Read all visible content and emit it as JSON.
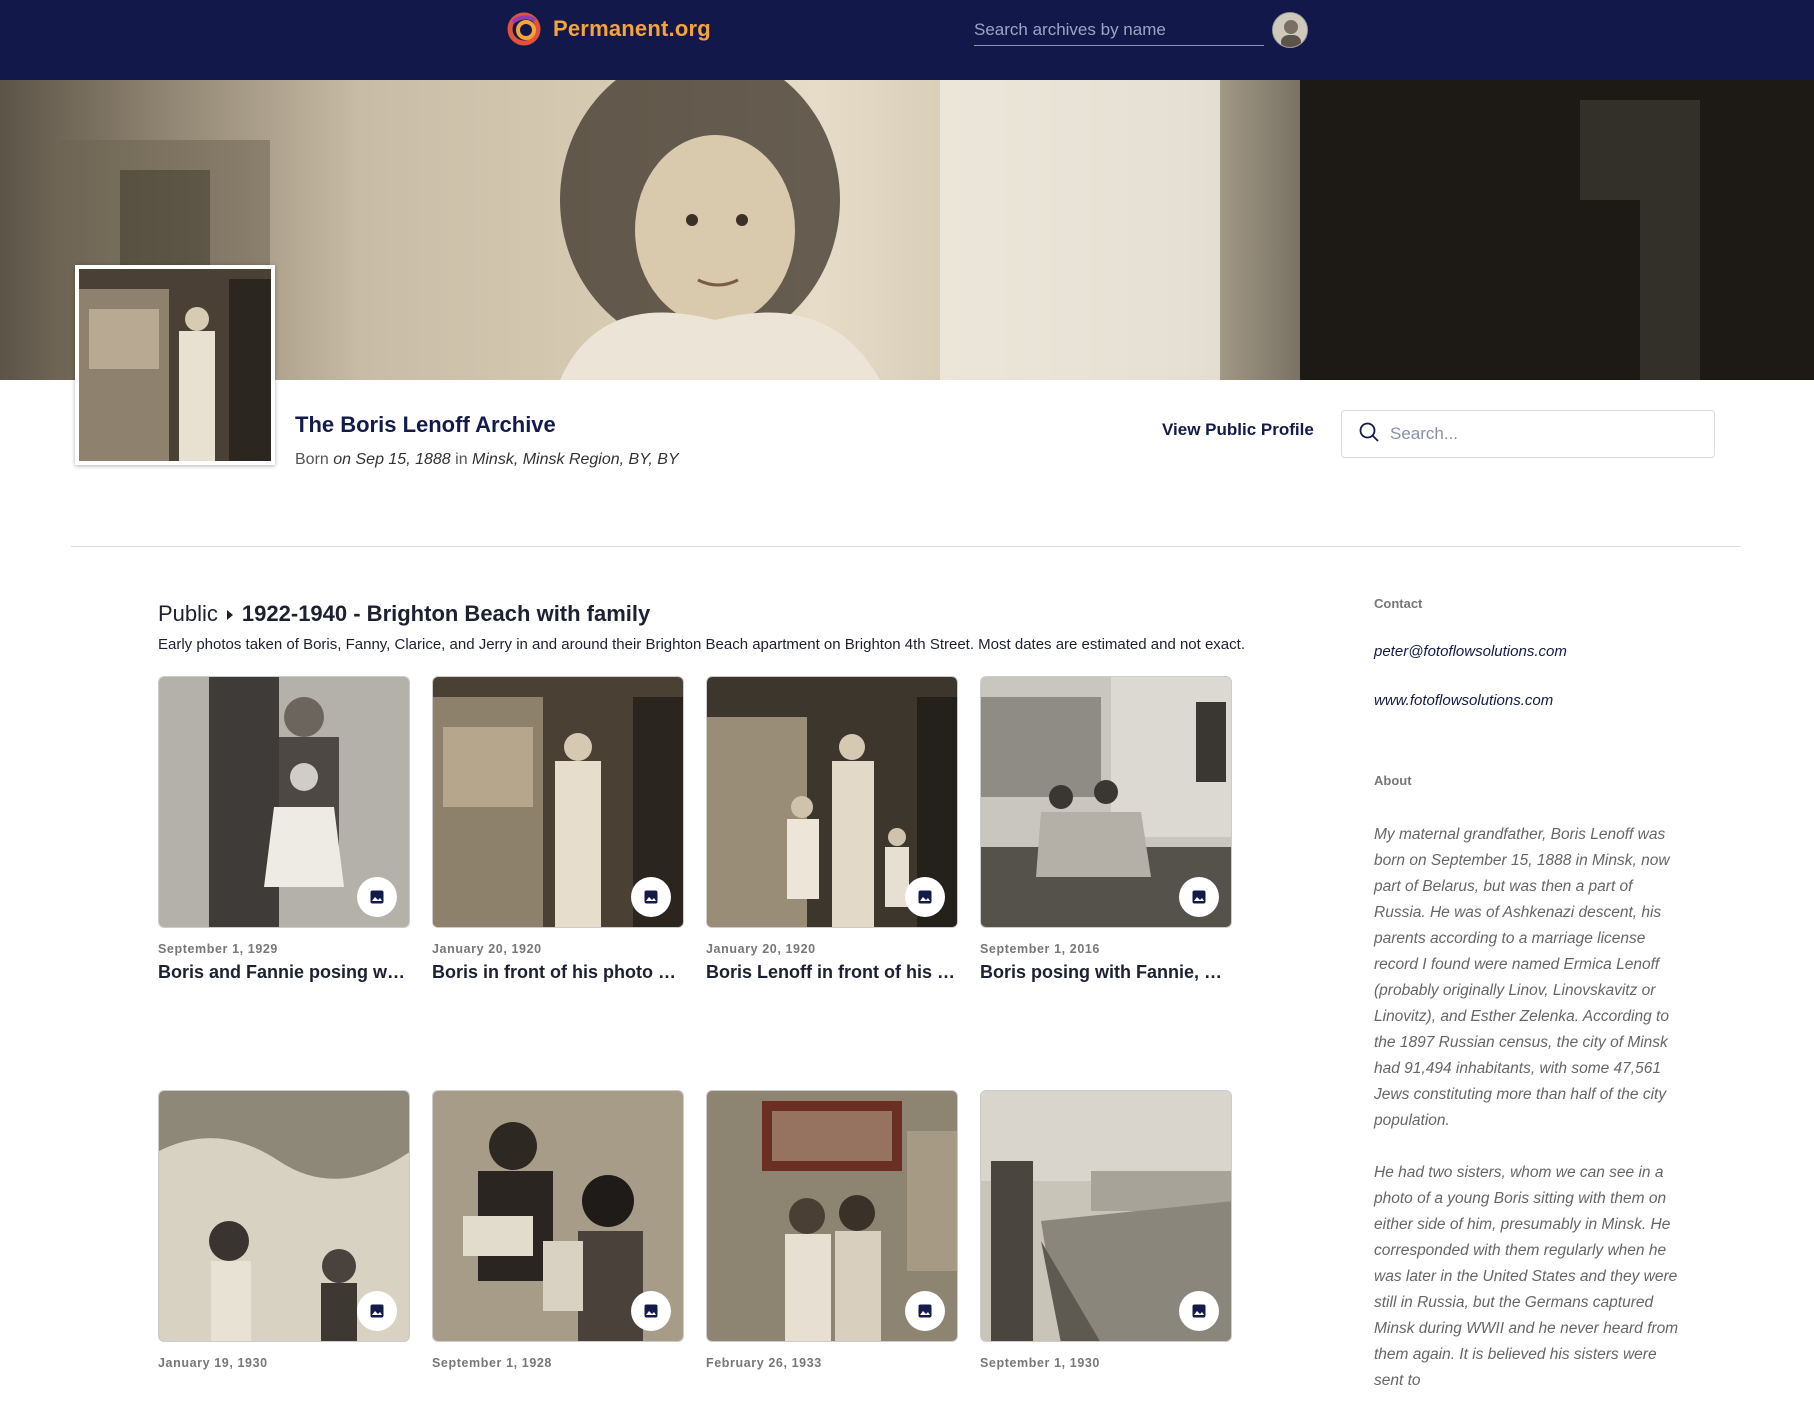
{
  "nav": {
    "logo_text": "Permanent.org",
    "search_placeholder": "Search archives by name",
    "brand_color": "#12194a",
    "accent_color": "#f6a33a"
  },
  "archive": {
    "title": "The Boris Lenoff Archive",
    "born_prefix": "Born",
    "born_date": "on Sep 15, 1888",
    "born_in": "in",
    "born_place": "Minsk, Minsk Region, BY, BY",
    "view_profile_label": "View Public Profile",
    "search_placeholder": "Search..."
  },
  "folder": {
    "breadcrumb_root": "Public",
    "breadcrumb_current": "1922-1940 - Brighton Beach with family",
    "description": "Early photos taken of Boris, Fanny, Clarice, and Jerry in and around their Brighton Beach apartment on Brighton 4th Street. Most dates are estimated and not exact."
  },
  "items": [
    {
      "date": "September 1, 1929",
      "title": "Boris and Fannie posing with ...",
      "icon": "image-icon"
    },
    {
      "date": "January 20, 1920",
      "title": "Boris in front of his photo studio",
      "icon": "image-icon"
    },
    {
      "date": "January 20, 1920",
      "title": "Boris Lenoff in front of his pho...",
      "icon": "image-icon"
    },
    {
      "date": "September 1, 2016",
      "title": "Boris posing with Fannie, Clari...",
      "icon": "image-icon"
    },
    {
      "date": "January 19, 1930",
      "title": "",
      "icon": "image-icon"
    },
    {
      "date": "September 1, 1928",
      "title": "",
      "icon": "image-icon"
    },
    {
      "date": "February 26, 1933",
      "title": "",
      "icon": "image-icon"
    },
    {
      "date": "September 1, 1930",
      "title": "",
      "icon": "image-icon"
    }
  ],
  "sidebar": {
    "contact_label": "Contact",
    "email": "peter@fotoflowsolutions.com",
    "website": "www.fotoflowsolutions.com",
    "about_label": "About",
    "about_p1": "My maternal grandfather, Boris Lenoff was born on September 15, 1888 in Minsk, now part of Belarus, but was then a part of Russia. He was of Ashkenazi descent, his parents according to a marriage license record I found were named Ermica Lenoff (probably originally Linov, Linovskavitz or Linovitz), and Esther Zelenka. According to the 1897 Russian census, the city of Minsk had 91,494 inhabitants, with some 47,561 Jews constituting more than half of the city population.",
    "about_p2": "He had two sisters, whom we can see in a photo of a young Boris sitting with them on either side of him, presumably in Minsk. He corresponded with them regularly when he was later in the United States and they were still in Russia, but the Germans captured Minsk during WWII and he never heard from them again. It is believed his sisters were sent to"
  }
}
